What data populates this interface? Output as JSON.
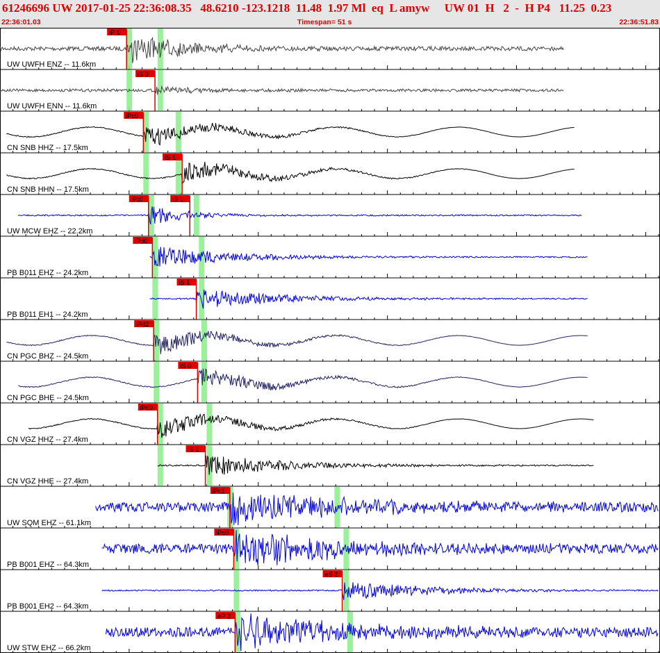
{
  "header": {
    "title": "61246696 UW 2017-01-25 22:36:08.35   48.6210 -123.1218  11.48  1.97 Ml  eq  L amyw     UW 01  H   2  -  H P4   11.25  0.23",
    "start_time": "22:36:01.03",
    "end_time": "22:36:51.83",
    "timespan": "Timespan=  51 s"
  },
  "colors": {
    "header_bg": "#e6e6e6",
    "header_text": "#e00000",
    "pick_red": "#e00000",
    "pick_window": "#90ee90",
    "trace_black": "#000000",
    "trace_gray": "#444444",
    "trace_blue": "#0000dd",
    "trace_navy": "#202060"
  },
  "chart_data": {
    "type": "seismogram",
    "x_range_s": [
      0,
      51
    ],
    "traces": [
      {
        "label": "UW UWFH ENZ -- 11.6km",
        "color": "gray",
        "t_start": 0,
        "t_end": 43.7,
        "amp": "high",
        "picks": [
          {
            "label": "iP 1",
            "t": 9.8
          }
        ],
        "windows": [
          9.8,
          12.2
        ]
      },
      {
        "label": "UW UWFH ENN -- 11.6km",
        "color": "gray",
        "t_start": 0,
        "t_end": 43.7,
        "amp": "low",
        "picks": [
          {
            "label": "iS 0",
            "t": 12.0
          }
        ],
        "windows": [
          9.8,
          12.2
        ]
      },
      {
        "label": "CN SNB HHZ -- 17.5km",
        "color": "black",
        "t_start": 0.5,
        "t_end": 44.5,
        "amp": "lowfreq",
        "picks": [
          {
            "label": "iPc0",
            "t": 11.1
          }
        ],
        "windows": [
          11.1,
          13.6
        ]
      },
      {
        "label": "CN SNB HHN -- 17.5km",
        "color": "black",
        "t_start": 0.5,
        "t_end": 44.5,
        "amp": "lowfreq",
        "picks": [
          {
            "label": "iS 1",
            "t": 14.1
          }
        ],
        "windows": [
          11.1,
          13.6
        ]
      },
      {
        "label": "UW MCW EHZ -- 22.2km",
        "color": "blue",
        "t_start": 1.4,
        "t_end": 45.1,
        "amp": "spike",
        "picks": [
          {
            "label": "iPc0",
            "t": 11.5
          },
          {
            "label": "iS 1",
            "t": 14.7
          }
        ],
        "windows": [
          11.5,
          15.0
        ]
      },
      {
        "label": "PB B011 EHZ -- 24.2km",
        "color": "blue",
        "t_start": 11.6,
        "t_end": 45.5,
        "amp": "medium",
        "picks": [
          {
            "label": "iPd0",
            "t": 11.8
          }
        ],
        "windows": [
          11.8,
          15.4
        ]
      },
      {
        "label": "PB B011 EH1 -- 24.2km",
        "color": "blue",
        "t_start": 11.6,
        "t_end": 45.5,
        "amp": "medium",
        "picks": [
          {
            "label": "iS 1",
            "t": 15.2
          }
        ],
        "windows": [
          11.8,
          15.4
        ]
      },
      {
        "label": "CN PGC BHZ -- 24.5km",
        "color": "navy",
        "t_start": 0.5,
        "t_end": 45.5,
        "amp": "lowfreq",
        "picks": [
          {
            "label": "iPd2",
            "t": 11.9
          }
        ],
        "windows": [
          11.9,
          15.6
        ]
      },
      {
        "label": "CN PGC BHE -- 24.5km",
        "color": "navy",
        "t_start": 1.4,
        "t_end": 45.5,
        "amp": "lowfreq",
        "picks": [
          {
            "label": "iS 0",
            "t": 15.3
          }
        ],
        "windows": [
          11.9,
          15.6
        ]
      },
      {
        "label": "CN VGZ HHZ -- 27.4km",
        "color": "black",
        "t_start": 2.2,
        "t_end": 46.0,
        "amp": "lowfreq",
        "picks": [
          {
            "label": "iPd0",
            "t": 12.2
          }
        ],
        "windows": [
          12.2,
          16.0
        ]
      },
      {
        "label": "CN VGZ HHE -- 27.4km",
        "color": "black",
        "t_start": 12.2,
        "t_end": 46.0,
        "amp": "medium",
        "picks": [
          {
            "label": "iS 1",
            "t": 15.9
          }
        ],
        "windows": [
          12.2,
          16.0
        ]
      },
      {
        "label": "UW SQM EHZ -- 61.1km",
        "color": "blue",
        "t_start": 7.4,
        "t_end": 51.0,
        "amp": "noisy",
        "picks": [
          {
            "label": "iPc1",
            "t": 17.8
          }
        ],
        "windows": [
          17.6,
          25.9
        ]
      },
      {
        "label": "PB B001 EHZ -- 64.3km",
        "color": "blue",
        "t_start": 7.9,
        "t_end": 51.0,
        "amp": "noisy",
        "picks": [
          {
            "label": "iPc0",
            "t": 18.1
          }
        ],
        "windows": [
          18.1,
          26.6
        ]
      },
      {
        "label": "PB B001 EH2 -- 64.3km",
        "color": "blue",
        "t_start": 7.9,
        "t_end": 51.0,
        "amp": "medium",
        "picks": [
          {
            "label": "eS 2",
            "t": 26.5
          }
        ],
        "windows": [
          18.1,
          26.6
        ]
      },
      {
        "label": "UW STW EHZ -- 66.2km",
        "color": "blue",
        "t_start": 8.2,
        "t_end": 51.0,
        "amp": "noisy",
        "picks": [
          {
            "label": "eP 2",
            "t": 18.2
          }
        ],
        "windows": [
          18.2,
          26.9
        ]
      }
    ]
  }
}
